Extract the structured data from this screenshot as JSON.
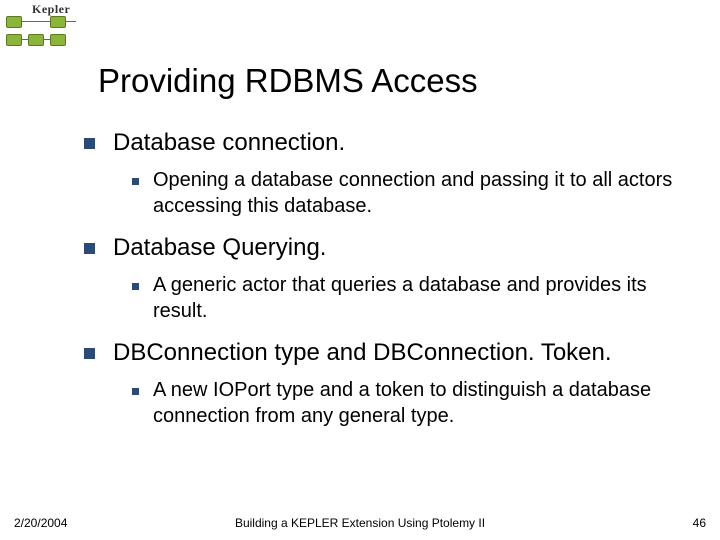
{
  "logo": {
    "text": "Kepler"
  },
  "title": "Providing RDBMS Access",
  "bullets": [
    {
      "text": "Database connection.",
      "sub": [
        "Opening a database connection and passing it to all actors accessing this database."
      ]
    },
    {
      "text": "Database Querying.",
      "sub": [
        "A generic actor that queries a database and provides its result."
      ]
    },
    {
      "text": "DBConnection type and DBConnection. Token.",
      "sub": [
        "A new IOPort type and a token to distinguish a database connection from any general type."
      ]
    }
  ],
  "footer": {
    "date": "2/20/2004",
    "title": "Building a KEPLER Extension Using Ptolemy II",
    "page": "46"
  }
}
